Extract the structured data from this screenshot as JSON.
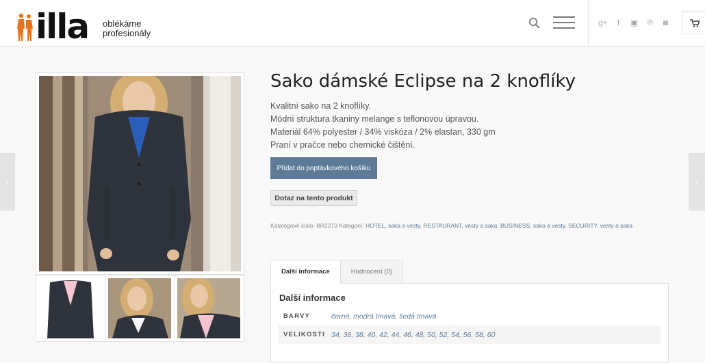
{
  "header": {
    "logo_word": "illa",
    "tagline_line1": "oblékáme",
    "tagline_line2": "profesionály",
    "social_icons": [
      "google-plus-icon",
      "facebook-icon",
      "youtube-icon",
      "pinterest-icon",
      "instagram-icon"
    ]
  },
  "product": {
    "title": "Sako dámské Eclipse na 2 knoflíky",
    "description": [
      "Kvalitní sako na 2 knoflíky.",
      "Módní struktura tkaniny melange s teflonovou úpravou.",
      "Materiál 64% polyester / 34% viskóza / 2% elastan, 330 gm",
      "Praní v pračce nebo chemické čištění."
    ],
    "add_button": "Přidat do poptávkového košíku",
    "ask_button": "Dotaz na tento produkt",
    "catalog_label": "Katalogové číslo:",
    "catalog_number": "BR2273",
    "categories_label": "Kategorií:",
    "categories": [
      "HOTEL, saka a vesty",
      "RESTAURANT, vesty a saka",
      "BUSINESS, saka a vesty",
      "SECURITY, vesty a saka"
    ]
  },
  "tabs": [
    {
      "label": "Další informace"
    },
    {
      "label": "Hodnocení (0)"
    }
  ],
  "panel": {
    "title": "Další informace",
    "rows": [
      {
        "label": "BARVY",
        "value": "černá, modrá tmavá, šedá tmavá"
      },
      {
        "label": "VELIKOSTI",
        "value": "34, 36, 38, 40, 42, 44, 46, 48, 50, 52, 54, 56, 58, 60"
      }
    ]
  },
  "colors": {
    "accent": "#5d7b96",
    "logo_orange": "#e8731c"
  }
}
